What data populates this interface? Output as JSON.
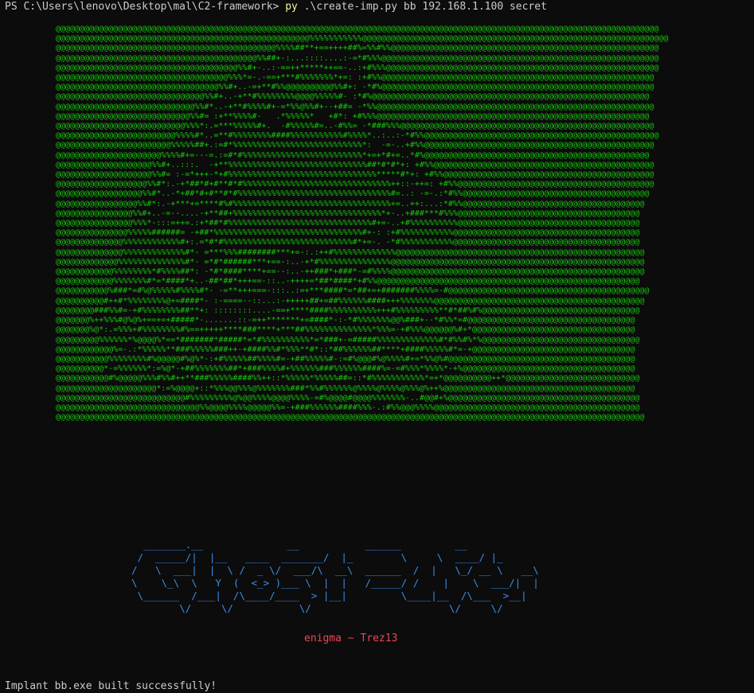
{
  "terminal": {
    "prompt_path": "PS C:\\Users\\lenovo\\Desktop\\mal\\C2-framework>",
    "command": "py",
    "command_args": ".\\create-imp.py bb 192.168.1.100 secret"
  },
  "art_lines": [
    "@@@@@@@@@@@@@@@@@@@@@@@@@@@@@@@@@@@@@@@@@@@@@@@@@@@@@@@@@@@@@@@@@@@@@@@@@@@@@@@@@@@@@@@@@@@@@@@@@@@@@@@@@@@@@@@@@@@@@@@@@@@@@@",
    "@@@@@@@@@@@@@@@@@@@@@@@@@@@@@@@@@@@@@@@@@@@@@@@@@@@@@%%%%%%%%%%%@@@@@@@@@@@@@@@@@@@@@@@@@@@@@@@@@@@@@@@@@@@@@@@@@@@@@@@@@@@@@@@@",
    "@@@@@@@@@@@@@@@@@@@@@@@@@@@@@@@@@@@@@@@@@@@@@@%%%%##**+==++++##%=%%#%%@@@@@@@@@@@@@@@@@@@@@@@@@@@@@@@@@@@@@@@@@@@@@@@@@@@@@@@@",
    "@@@@@@@@@@@@@@@@@@@@@@@@@@@@@@@@@@@@@@@@@@%%##+-:...::::....:-=*#%%%@@@@@@@@@@@@@@@@@@@@@@@@@@@@@@@@@@@@@@@@@@@@@@@@@@@@@@@@@@",
    "@@@@@@@@@@@@@@@@@@@@@@@@@@@@@@@@@@@@@@%%#+-..:-==++*****++==-..:+#%%%@@@@@@@@@@@@@@@@@@@@@@@@@@@@@@@@@@@@@@@@@@@@@@@@@@@@@@@@@",
    "@@@@@@@@@@@@@@@@@@@@@@@@@@@@@@@@@@@@%%%*=-.-==+***#%%%%%%%*+=: :+#%%@@@@@@@@@@@@@@@@@@@@@@@@@@@@@@@@@@@@@@@@@@@@@@@@@@@@@@@@@",
    "@@@@@@@@@@@@@@@@@@@@@@@@@@@@@@@@@@%%#+..-=+**#%%@@@@@@@@@@%%#+: -*#%@@@@@@@@@@@@@@@@@@@@@@@@@@@@@@@@@@@@@@@@@@@@@@@@@@@@@@@@@",
    "@@@@@@@@@@@@@@@@@@@@@@@@@@@@@@@%%#+..-+**#%%%%%%%%@@@@%%%%%#- :*#%@@@@@@@@@@@@@@@@@@@@@@@@@@@@@@@@@@@@@@@@@@@@@@@@@@@@@@@@@@",
    "@@@@@@@@@@@@@@@@@@@@@@@@@@@@@%%#*..-+**#%%%%#+-=*%%@%%#+--+##= -*%%@@@@@@@@@@@@@@@@@@@@@@@@@@@@@@@@@@@@@@@@@@@@@@@@@@@@@@@@@@",
    "@@@@@@@@@@@@@@@@@@@@@@@@@@@@%%#= :+**%%%%#-   .*%%%%%*   +#*: +#%%%@@@@@@@@@@@@@@@@@@@@@@@@@@@@@@@@@@@@@@@@@@@@@@@@@@@@@@@@@",
    "@@@@@@@@@@@@@@@@@@@@@@@@@@@%%%*:.=***%%%%%#+.  -#%%%%%#=..-#%%= -*###%%%@@@@@@@@@@@@@@@@@@@@@@@@@@@@@@@@@@@@@@@@@@@@@@@@@@@@@",
    "@@@@@@@@@@@@@@@@@@@@@@@@@%%%%#*..=**#%%%%%%%%####%%%%%%%%%%%#%%%%*..:..:-*#%%@@@@@@@@@@@@@@@@@@@@@@@@@@@@@@@@@@@@@@@@@@@@@@@@@",
    "@@@@@@@@@@@@@@@@@@@@@@@@%%%%%##+.:=#*%%%%%%%%%%%%%%%%%%%%%%%%%%%*:  -=-..+#%%@@@@@@@@@@@@@@@@@@@@@@@@@@@@@@@@@@@@@@@@@@@@@@@@",
    "@@@@@@@@@@@@@@@@@@@@@@%%%%#+=---=.:=#*#%%%%%%%%%%%%%%%%%%%%%%%%%*+=+*#+=..*#%@@@@@@@@@@@@@@@@@@@@@@@@@@@@@@@@@@@@@@@@@@@@@@@",
    "@@@@@@@@@@@@@@@@@@@@%%#+..:::.  -+**%%%%%%%%%%%%%%%%%%%%%%%%%%%%%##*#*#*+: +#%%@@@@@@@@@@@@@@@@@@@@@@@@@@@@@@@@@@@@@@@@@@@@@@",
    "@@@@@@@@@@@@@@@@@@@@%%#= :-=*+++-*+#%%%%%%%%%%%%%%%%%%%%%%%%%%%%%%%*****#*+: +#%%@@@@@@@@@@@@@@@@@@@@@@@@@@@@@@@@@@@@@@@@@@@@",
    "@@@@@@@@@@@@@@@@@@@%%#*:.-+*##*#+#**#*#%%%%%%%%%%%%%%%%%%%%%%%%%%%%%%%++::-++=: +#%%@@@@@@@@@@@@@@@@@@@@@@@@@@@@@@@@@@@@@@@@@",
    "@@@@@@@@@@@@@@@@@@%%#*..-*+##*#+#**#*#%%%%%%%%%%%%%%%%%%%%%%%%%%%%%%%%#=..: -=-.:*#%%@@@@@@@@@@@@@@@@@@@@@@@@@@@@@@@@@@@@@@@",
    "@@@@@@@@@@@@@@@@@%%#*:.-+***+=****#%#%%%%%%%%%%%%%%%%%%%%%%%%%%%%%%%%%+=..++:...:*#%%@@@@@@@@@@@@@@@@@@@@@@@@@@@@@@@@@@@@@@",
    "@@@@@@@@@@@@@@@@%%#+..-=--....-+**##+%%%%%%%%%%%%%%%%%%%%%%%%%%%%%%%*+-..+###***#%%%@@@@@@@@@@@@@@@@@@@@@@@@@@@@@@@@@@@@@@",
    "@@@@@@@@@@@@@@@@%%%*-:::=++=.:+*##*#%%%%%%%%%%%%%%%%%%%%%%%%%%%%%%#+=-..+#%%%%%%%%%%@@@@@@@@@@@@@@@@@@@@@@@@@@@@@@@@@@@@@@",
    "@@@@@@@@@@@@@@@%%%%%######= -+##*%%%%%%%%%%%%%%%%%%%%%%%%%%%%%%%#+-: :+#%%%%%%%%%%%@@@@@@@@@@@@@@@@@@@@@@@@@@@@@@@@@@@@@@@",
    "@@@@@@@@@@@@@@%%%%%%%%%%%%#+:.=*#*#%%%%%%%%%%%%%%%%%%%%%%%%%%%#*+=-. -*#%%%%%%%%%%%@@@@@@@@@@@@@@@@@@@@@@@@@@@@@@@@@@@@@@@",
    "@@@@@@@@@@@@@@%%%%%%%%%%%%%#*- =***%%%########***+=-:.:++#%%%%%%%%%%%%%@@@@@@@@@@@@@@@@@@@@@@@@@@@@@@@@@@@@@@@@@@@@@@@@@@@@",
    "@@@@@@@@@@@@@%%%%%%%%%%%%%%#*- =*#*######***+==-:..-+*#%%%%%%%%%%%%%%%@@@@@@@@@@@@@@@@@@@@@@@@@@@@@@@@@@@@@@@@@@@@@@@@@@@@@",
    "@@@@@@@@@@@@%%%%%%%%*#%%%%##*: -*#*####****+==--:..-++###*+###*-=#%%%%@@@@@@@@@@@@@@@@@@@@@@@@@@@@@@@@@@@@@@@@@@@@@@@@@@@@@",
    "@@@@@@@@@@@@%%%%%%%#*=*####*+..-##*##*+++==-::..-++++=*##*####*+#%%@@@@@@@@@@@@@@@@@@@@@@@@@@@@@@@@@@@@@@@@@@@@@@@@@@@@@@@",
    "@@@@@@@@@@@%###*=#%@%%%%%#%%%%#*- -=**+++===-:::..:=+***####*=*##+=+#######%%%%=-#@@@@@@@@@@@@@@@@@@@@@@@@@@@@@@@@@@@@@@@@@@",
    "@@@@@@@@@@#++#*%%%%%%%%@+=####*- :-====--::...:-+++++##+=##%%%%%%####+++%%%%%%%@@@@@@@@@@@@@@@@@@@@@@@@@@@@@@@@@@@@@@@@@@@@",
    "@@@@@@@@###%%#=-+#%%%%%%%%##**+: ::::::::....-==+****####%%%%%%%%%%+++#%%%%%%%%%**#*##%#%@@@@@@@@@@@@@@@@@@@@@@@@@@@@@@@@@",
    "@@@@@@@%++%%%#@%@%+==+=+#####*-.......::-=++*******+=####*-:-*#%%%%%%%@@%###+--*#%%*=#@@@@@@@@@@@@@@@@@@@@@@@@@@@@@@@@@@@",
    "@@@@@@@%@*:.=%%%+#%%%%%%%%#%==+++++****###****+***##%%%%%%%%%%%%%%*%%%=-+#%%%@@@@@@%#+*@@@@@@@@@@@@@@@@@@@@@@@@@@@@@@@@@@",
    "@@@@@@@@@%%%%%%*%@@@@%*==*#######*#####*=*#%%%%%%%%%%*=*###+-=#####%%%%%%%%%%%%%#*#%%#%*%@@@@@@@@@@@@@@@@@@@@@@@@@@@@@@@@@",
    "@@@@@@@@@@@@%=-.:*%%%%%**###%%%%%###++-+####%%#*%%%**#*::*##%%%%%%##****+####%%%%%#*=-+@@@@@@@@@@@@@@@@@@@@@@@@@@@@@@@@@@",
    "@@@@@@@@@@@%%%%%%%%#%@@@@@#%@%*-:+#%%%%%##%%%%#=-+##%%%%%#-:=#%@@@#%@%%%%#+=*%%@%#@@@@@@@@@@@@@@@@@@@@@@@@@@@@@@@@@@@@@@@",
    "@@@@@@@@@@*-=%%%%%%*:=%@*-+##%%%%%%%##*+###%%%%#+%%%%%%###%%%%%%####%=-=#%%%*%%%%*-+%@@@@@@@@@@@@@@@@@@@@@@@@@@@@@@@@@@@@",
    "@@@@@@@@@@@#%@@@@@%%%#%%#++**###%%%%%####%%++::*%%%%%*%%%%%##=::*#%%%%%%%%%%%*=+*@@@@@@@@@@++*@@@@@@@@@@@@@@@@@@@@@@@@@@@@",
    "@@@@@@@@@@@@@@@@@@@@@*:=%@@@@+::*%%%@@%%%@%%%%%%%###*%%#%%%%%%@%%%%@%%%%@%%%@%++%@@@@@@@@@@@@@@@@@@@@@@@@@@@@@@@@@@@@@@@@",
    "@@@@@@@@@@@@@@@@@@@@@@@@@@@#%%%%%%%%%@%@@%%%%@@@@%%%%-=#%@@@@#@@@@%%%%%%%-..#@@#+%@@@@@@@@@@@@@@@@@@@@@@@@@@@@@@@@@@@@@@@@",
    "@@@@@@@@@@@@@@@@@@@@@@@@@@@@@@%%@@@@%%%%@@@@@%%=-+###%%%%%%####%%%-.:#%%@@@%%%%@@@@@@@@@@@@@@@@@@@@@@@@@@@@@@@@@@@@@@@@@@@",
    "@@@@@@@@@@@@@@@@@@@@@@@@@@@@@@@@@@@@@@@@@@@@@@@@@@@@@@@@@@@@@@@@@@@@@@@@@@@@@@@@@@@@@@@@@@@@@@@@@@@@@@@@@@@@@@@@@@@@@@@@@@@"
  ],
  "banner_lines": [
    "  _______.__              __           ______         __",
    " /  _____/|  |__   ____  _______/  |_        \\     \\  ____/ |_",
    "/   \\  ___|  |  \\ /  _ \\/  ___/\\  __\\  ______  /  |   \\_/ __ \\   __\\",
    "\\    \\_\\  \\   Y  (  <_> )___ \\  |  |   /_____/ /    |    \\  ___/|  |",
    " \\______  /___|  /\\____/____  > |__|         \\____|__  /\\___  >__|",
    "        \\/     \\/           \\/                       \\/     \\/"
  ],
  "credit": "enigma ~ Trez13",
  "result_message": "Implant bb.exe built successfully!",
  "colors": {
    "background": "#0c0c0c",
    "prompt_text": "#cccccc",
    "command": "#f9f1a5",
    "art": "#16c60c",
    "banner": "#3b8eea",
    "credit": "#e74856"
  }
}
